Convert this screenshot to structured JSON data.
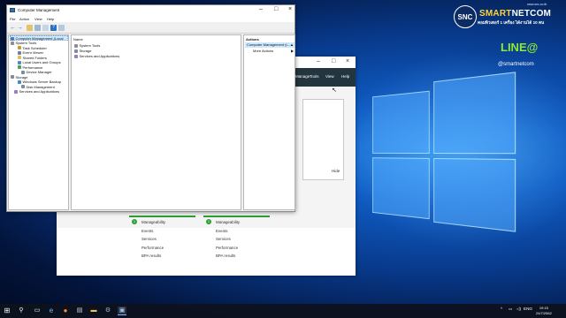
{
  "brand": {
    "circle": "SNC",
    "name_a": "SMART",
    "name_b": "NETCOM",
    "tagline": "คอมพิวเตอร์ 1 เครื่อง ได้งานได้ 10 คน",
    "site": "www.snc.co.th",
    "line_logo": "LINE@",
    "line_id": "@smartnetcom"
  },
  "computer_management": {
    "title": "Computer Management",
    "menu": [
      "File",
      "Action",
      "View",
      "Help"
    ],
    "tree": [
      "Computer Management (Local",
      "System Tools",
      "Task Scheduler",
      "Event Viewer",
      "Shared Folders",
      "Local Users and Groups",
      "Performance",
      "Device Manager",
      "Storage",
      "Windows Server Backup",
      "Disk Management",
      "Services and Applications"
    ],
    "middle": {
      "header": "Name",
      "rows": [
        "System Tools",
        "Storage",
        "Services and Applications"
      ]
    },
    "actions": {
      "header": "Actions",
      "selected": "Computer Management (L...",
      "more": "More Actions"
    }
  },
  "server_manager": {
    "menu": [
      "Manage",
      "Tools",
      "View",
      "Help"
    ],
    "hide": "Hide",
    "columns": [
      {
        "header": "Services",
        "rows": [
          "Manageability",
          "Events",
          "Services",
          "Performance",
          "BPA results"
        ]
      },
      {
        "header": "",
        "rows": [
          "Manageability",
          "Events",
          "Services",
          "Performance",
          "BPA results"
        ]
      }
    ]
  },
  "taskbar": {
    "lang": "ENG",
    "time": "19:15",
    "date": "24/7/2562"
  }
}
